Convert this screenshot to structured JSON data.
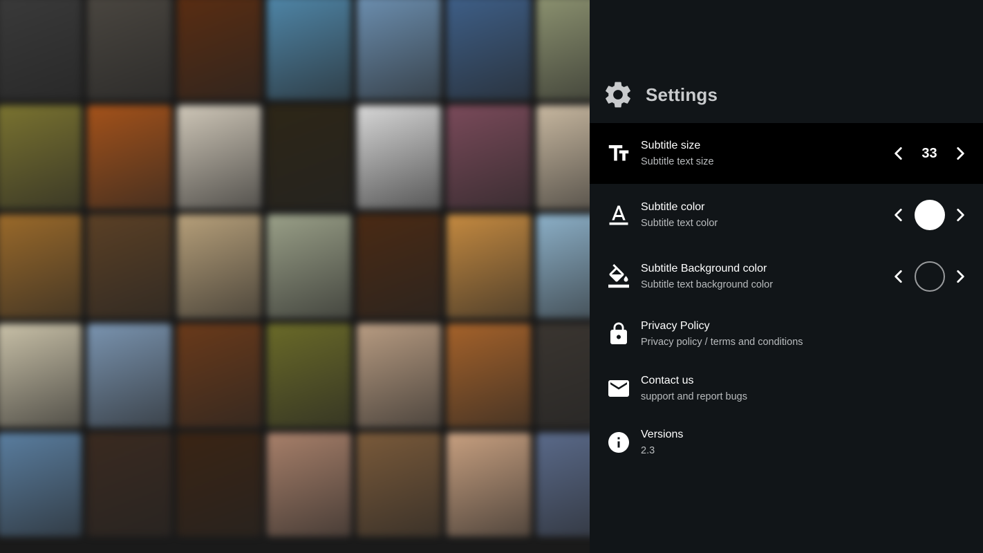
{
  "settings": {
    "title": "Settings",
    "icon": "gear-icon",
    "items": [
      {
        "id": "subtitle-size",
        "icon": "text-size-icon",
        "title": "Subtitle size",
        "subtitle": "Subtitle text size",
        "value": "33",
        "selected": true
      },
      {
        "id": "subtitle-color",
        "icon": "text-color-icon",
        "title": "Subtitle color",
        "subtitle": "Subtitle text color",
        "color": "#ffffff"
      },
      {
        "id": "subtitle-background-color",
        "icon": "paint-bucket-icon",
        "title": "Subtitle Background color",
        "subtitle": "Subtitle text background color",
        "color": "transparent"
      },
      {
        "id": "privacy-policy",
        "icon": "lock-icon",
        "title": "Privacy Policy",
        "subtitle": "Privacy policy / terms and conditions"
      },
      {
        "id": "contact-us",
        "icon": "mail-icon",
        "title": "Contact us",
        "subtitle": "support and report bugs"
      },
      {
        "id": "versions",
        "icon": "info-icon",
        "title": "Versions",
        "subtitle": "2.3"
      }
    ]
  },
  "theme": {
    "panel_background": "#111518",
    "selected_row_background": "#000000",
    "header_text": "#c9cbcd"
  },
  "background": {
    "poster_colors": [
      [
        "#3a3a3a",
        "#4a4640",
        "#5a2d12",
        "#4f86a8",
        "#6c8fb0",
        "#3e5f88",
        "#8c9270"
      ],
      [
        "#7a7330",
        "#a4521a",
        "#cfc7b8",
        "#2d2617",
        "#d8d8d8",
        "#7a4a5a",
        "#c8b8a0"
      ],
      [
        "#9b6a2a",
        "#5b4025",
        "#b7a07a",
        "#9aa088",
        "#4a2a14",
        "#c58a40",
        "#8cb0c8"
      ],
      [
        "#c9c1a8",
        "#7a94b0",
        "#6a3a1a",
        "#6a6a28",
        "#b89c82",
        "#a5622a",
        "#3a3530"
      ],
      [
        "#5a7ea0",
        "#3a2a20",
        "#3a2414",
        "#a8806a",
        "#7a5a3a",
        "#c8a080",
        "#5a6a8a"
      ]
    ]
  }
}
